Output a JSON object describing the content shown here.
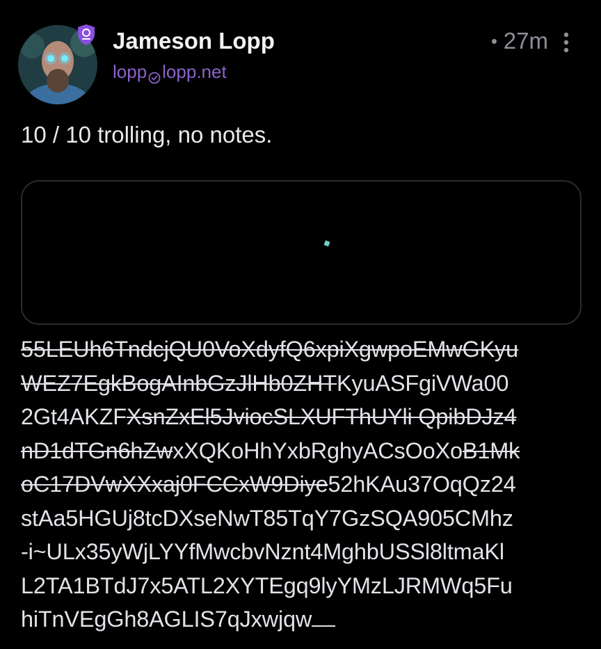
{
  "colors": {
    "background": "#000000",
    "name": "#f2f2f5",
    "handle": "#8b62c9",
    "meta": "#8e8e99",
    "badge": "#8a4fe0",
    "spinner": "#6fd0c8",
    "card_border": "#2b2b32"
  },
  "post": {
    "author": {
      "name": "Jameson Lopp",
      "handle_user": "lopp",
      "handle_domain": "lopp.net",
      "avatar_icon": "profile-photo",
      "badge_icon": "verified-shield-icon"
    },
    "timestamp": "27m",
    "menu_icon": "more-vertical-icon",
    "text": "10 / 10 trolling, no notes.",
    "media": {
      "state_icon": "loading-spinner-icon"
    },
    "body_lines": [
      {
        "strike": "55LEUh6TndcjQU0VoXdyfQ6xpiXgwpoEMwGKyu",
        "plain": ""
      },
      {
        "strike": "WEZ7EgkBogAInbGzJlHb0ZHT",
        "plain": "KyuASFgiVWa00"
      },
      {
        "pre": "2Gt4AKZF",
        "strike": "XsnZxEl5JviocSLXUFThUYli QpibDJz4",
        "plain": ""
      },
      {
        "strike": "nD1dTGn6hZw",
        "plain": "xXQKoHhYxbRghyACsOoXo",
        "post_strike": "B1Mk"
      },
      {
        "strike": "oC17DVwXXxaj0FCCxW9Diye",
        "plain": "52hKAu37OqQz24"
      },
      {
        "strike": "",
        "plain": "stAa5HGUj8tcDXseNwT85TqY7GzSQA905CMhz"
      },
      {
        "strike": "",
        "plain": "-i~ULx35yWjLYYfMwcbvNznt4MghbUSSl8ltmaKl"
      },
      {
        "strike": "",
        "plain": "L2TA1BTdJ7x5ATL2XYTEgq9lyYMzLJRMWq5Fu"
      },
      {
        "strike": "",
        "plain": "hiTnVEgGh8AGLIS7qJxwjqw"
      }
    ]
  }
}
